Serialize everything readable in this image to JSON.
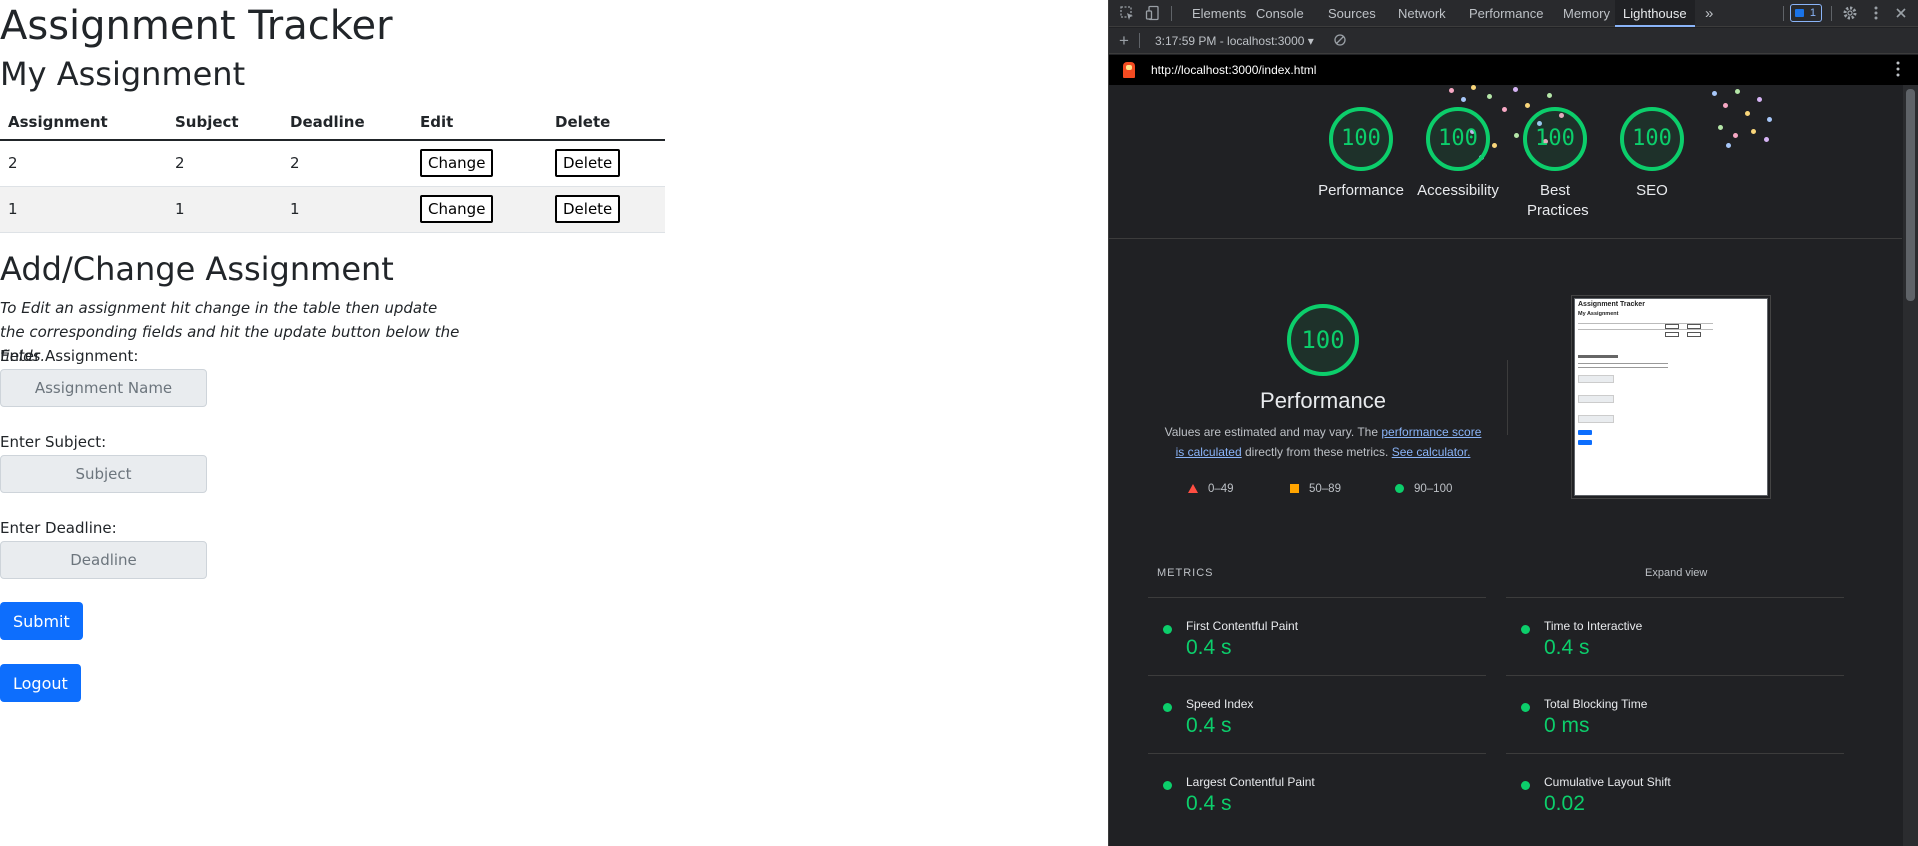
{
  "app": {
    "title": "Assignment Tracker",
    "table_title": "My Assignment",
    "table_headers": [
      "Assignment",
      "Subject",
      "Deadline",
      "Edit",
      "Delete"
    ],
    "rows": [
      {
        "assignment": "2",
        "subject": "2",
        "deadline": "2",
        "edit": "Change",
        "delete": "Delete"
      },
      {
        "assignment": "1",
        "subject": "1",
        "deadline": "1",
        "edit": "Change",
        "delete": "Delete"
      }
    ],
    "form_title": "Add/Change Assignment",
    "instructions": "To Edit an assignment hit change in the table then update the corresponding fields and hit the update button below the fields.",
    "assignment_label": "Enter Assignment:",
    "assignment_placeholder": "Assignment Name",
    "subject_label": "Enter Subject:",
    "subject_placeholder": "Subject",
    "deadline_label": "Enter Deadline:",
    "deadline_placeholder": "Deadline",
    "submit_label": "Submit",
    "logout_label": "Logout",
    "accent_color": "#0d6efd"
  },
  "devtools": {
    "tabs": [
      "Elements",
      "Console",
      "Sources",
      "Network",
      "Performance",
      "Memory",
      "Lighthouse"
    ],
    "active_tab": "Lighthouse",
    "more_tabs": "»",
    "issues_count": "1",
    "add_icon": "+",
    "report_selector": "3:17:59 PM - localhost:3000 ▾",
    "url": "http://localhost:3000/index.html",
    "scores": [
      {
        "value": "100",
        "label": "Performance"
      },
      {
        "value": "100",
        "label": "Accessibility"
      },
      {
        "value": "100",
        "label": "Best Practices"
      },
      {
        "value": "100",
        "label": "SEO"
      }
    ],
    "perf_score": "100",
    "perf_title": "Performance",
    "perf_desc_1": "Values are estimated and may vary. The ",
    "perf_link_1": "performance score is calculated",
    "perf_desc_2": " directly from these metrics. ",
    "perf_link_2": "See calculator.",
    "legend": [
      {
        "shape": "triangle",
        "range": "0–49",
        "color": "#ff4e42"
      },
      {
        "shape": "square",
        "range": "50–89",
        "color": "#ffa400"
      },
      {
        "shape": "circle",
        "range": "90–100",
        "color": "#0cce6b"
      }
    ],
    "metrics_title": "METRICS",
    "expand_label": "Expand view",
    "metrics": [
      {
        "name": "First Contentful Paint",
        "value": "0.4 s"
      },
      {
        "name": "Time to Interactive",
        "value": "0.4 s"
      },
      {
        "name": "Speed Index",
        "value": "0.4 s"
      },
      {
        "name": "Total Blocking Time",
        "value": "0 ms"
      },
      {
        "name": "Largest Contentful Paint",
        "value": "0.4 s"
      },
      {
        "name": "Cumulative Layout Shift",
        "value": "0.02"
      }
    ],
    "pass_color": "#0cce6b",
    "thumbnail": {
      "title": "Assignment Tracker",
      "subtitle": "My Assignment"
    }
  }
}
